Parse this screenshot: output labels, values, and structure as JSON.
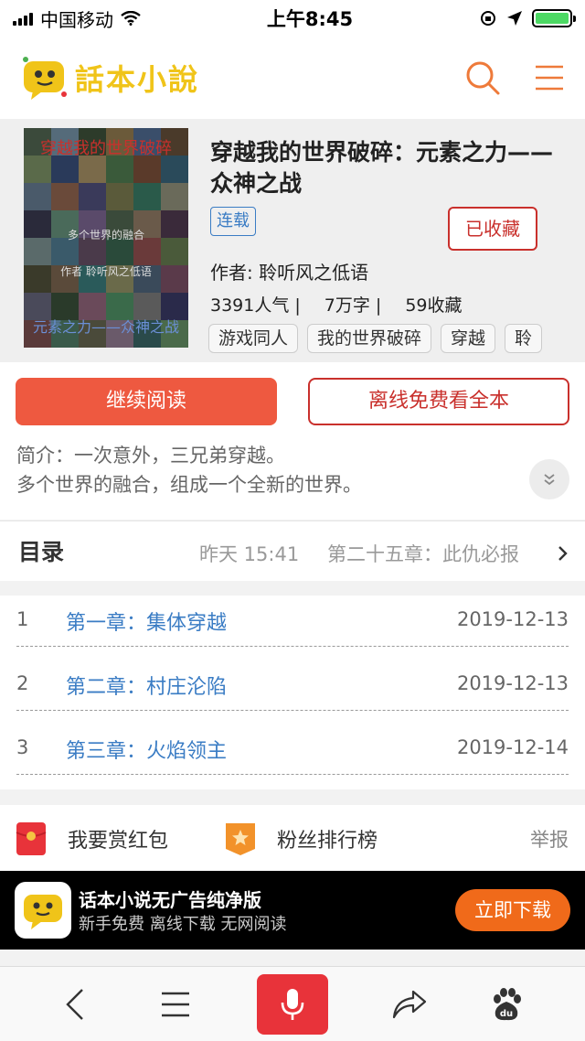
{
  "status_bar": {
    "carrier": "中国移动",
    "time": "上午8:45"
  },
  "header": {
    "logo_text": "話本小說",
    "icons": [
      "search-icon",
      "menu-icon"
    ]
  },
  "book": {
    "cover_title": "穿越我的世界破碎",
    "cover_subtitle": "元素之力——众神之战",
    "cover_middle_1": "多个世界的融合",
    "cover_middle_2": "作者  聆听风之低语",
    "title": "穿越我的世界破碎：元素之力——众神之战",
    "status": "连载",
    "collected_label": "已收藏",
    "author": "作者: 聆听风之低语",
    "popularity": "3391人气 |",
    "words": "7万字 |",
    "favorites": "59收藏",
    "tags": [
      "游戏同人",
      "我的世界破碎",
      "穿越",
      "聆"
    ]
  },
  "actions": {
    "continue_label": "继续阅读",
    "offline_label": "离线免费看全本",
    "intro_line_1": "简介：一次意外，三兄弟穿越。",
    "intro_line_2": "多个世界的融合，组成一个全新的世界。"
  },
  "catalog": {
    "title": "目录",
    "updated": "昨天 15:41",
    "latest_chapter": "第二十五章：此仇必报",
    "chapters": [
      {
        "num": "1",
        "name": "第一章：集体穿越",
        "date": "2019-12-13"
      },
      {
        "num": "2",
        "name": "第二章：村庄沦陷",
        "date": "2019-12-13"
      },
      {
        "num": "3",
        "name": "第三章：火焰领主",
        "date": "2019-12-14"
      }
    ]
  },
  "reward": {
    "red_packet": "我要赏红包",
    "fan_rank": "粉丝排行榜",
    "report": "举报"
  },
  "banner": {
    "title": "话本小说无广告纯净版",
    "subtitle": "新手免费 离线下载 无网阅读",
    "button": "立即下载"
  },
  "colors": {
    "accent_red": "#ee5940",
    "link_blue": "#3a7cc4",
    "download_orange": "#f06a1a",
    "mic_red": "#e8333a"
  }
}
